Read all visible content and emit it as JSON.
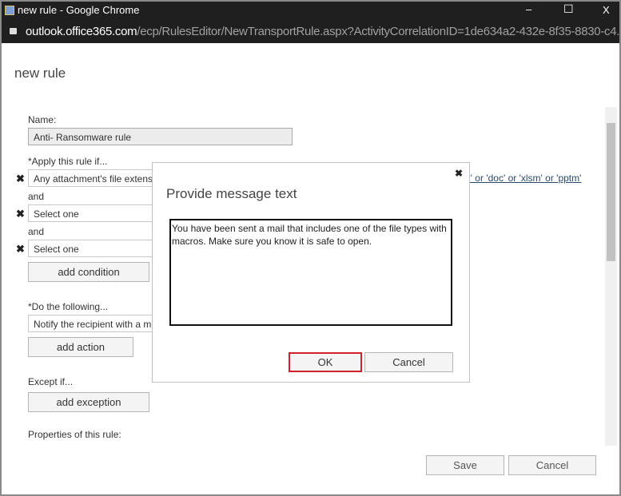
{
  "window": {
    "title": "new rule - Google Chrome",
    "minimize": "–",
    "maximize": "☐",
    "close": "X"
  },
  "address": {
    "domain": "outlook.office365.com",
    "path": "/ecp/RulesEditor/NewTransportRule.aspx?ActivityCorrelationID=1de634a2-432e-8f35-8830-c4..."
  },
  "page": {
    "title": "new rule",
    "name_label": "Name:",
    "name_value": "Anti- Ransomware rule",
    "apply_label": "*Apply this rule if...",
    "condition1": "Any attachment's file extens",
    "condition1_link": "n' or 'doc' or 'xlsm' or 'pptm'",
    "and1": "and",
    "condition2": "Select one",
    "and2": "and",
    "condition3": "Select one",
    "add_condition": "add condition",
    "do_label": "*Do the following...",
    "action1": "Notify the recipient with a m",
    "add_action": "add action",
    "except_label": "Except if...",
    "add_exception": "add exception",
    "properties_label": "Properties of this rule:",
    "save": "Save",
    "cancel": "Cancel",
    "remove": "✖"
  },
  "dialog": {
    "title": "Provide message text",
    "close": "✖",
    "message": "You have been sent a mail that includes one of the file types with macros. Make sure you know it is safe to open.",
    "ok": "OK",
    "cancel": "Cancel"
  }
}
